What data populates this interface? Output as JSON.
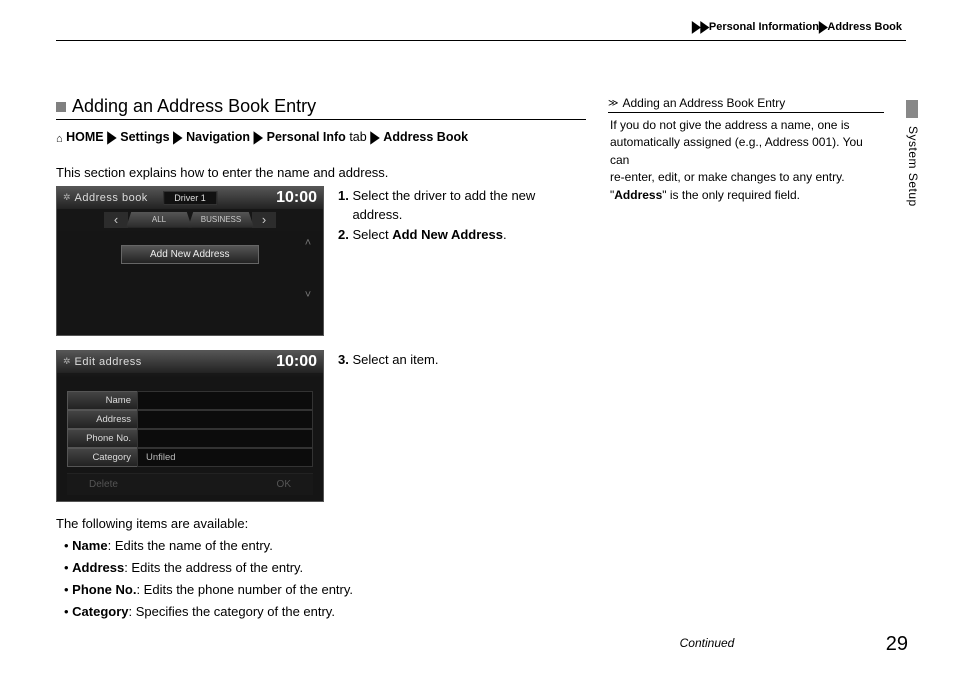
{
  "header": {
    "breadcrumb_prefix": "▶▶",
    "breadcrumb1": "Personal Information",
    "breadcrumb_sep": "▶",
    "breadcrumb2": "Address Book"
  },
  "side_tab_label": "System Setup",
  "section": {
    "title": "Adding an Address Book Entry",
    "path_home": "HOME",
    "path_sep": "▶",
    "path_settings": "Settings",
    "path_nav": "Navigation",
    "path_personal": "Personal Info",
    "path_tab_word": "tab",
    "path_addr": "Address Book",
    "intro": "This section explains how to enter the name and address."
  },
  "screen1": {
    "title": "Address book",
    "driver": "Driver 1",
    "clock": "10:00",
    "tab_all": "ALL",
    "tab_business": "BUSINESS",
    "add_btn": "Add New Address"
  },
  "steps1": {
    "s1_num": "1.",
    "s1a": "Select the driver to add the new",
    "s1b": "address.",
    "s2_num": "2.",
    "s2a": "Select ",
    "s2b": "Add New Address",
    "s2c": "."
  },
  "screen2": {
    "title": "Edit address",
    "clock": "10:00",
    "row_name": "Name",
    "row_address": "Address",
    "row_phone": "Phone No.",
    "row_category": "Category",
    "val_category": "Unfiled",
    "btn_delete": "Delete",
    "btn_ok": "OK"
  },
  "steps2": {
    "s3_num": "3.",
    "s3a": "Select an item."
  },
  "available": {
    "intro": "The following items are available:",
    "b1_label": "Name",
    "b1_text": ": Edits the name of the entry.",
    "b2_label": "Address",
    "b2_text": ": Edits the address of the entry.",
    "b3_label": "Phone No.",
    "b3_text": ": Edits the phone number of the entry.",
    "b4_label": "Category",
    "b4_text": ": Specifies the category of the entry."
  },
  "sidebar": {
    "title": "Adding an Address Book Entry",
    "line1": "If you do not give the address a name, one is",
    "line2": "automatically assigned (e.g., Address 001). You can",
    "line3": "re-enter, edit, or make changes to any entry.",
    "line4a": "\"",
    "line4b": "Address",
    "line4c": "\" is the only required field."
  },
  "footer": {
    "continued": "Continued",
    "page": "29"
  }
}
